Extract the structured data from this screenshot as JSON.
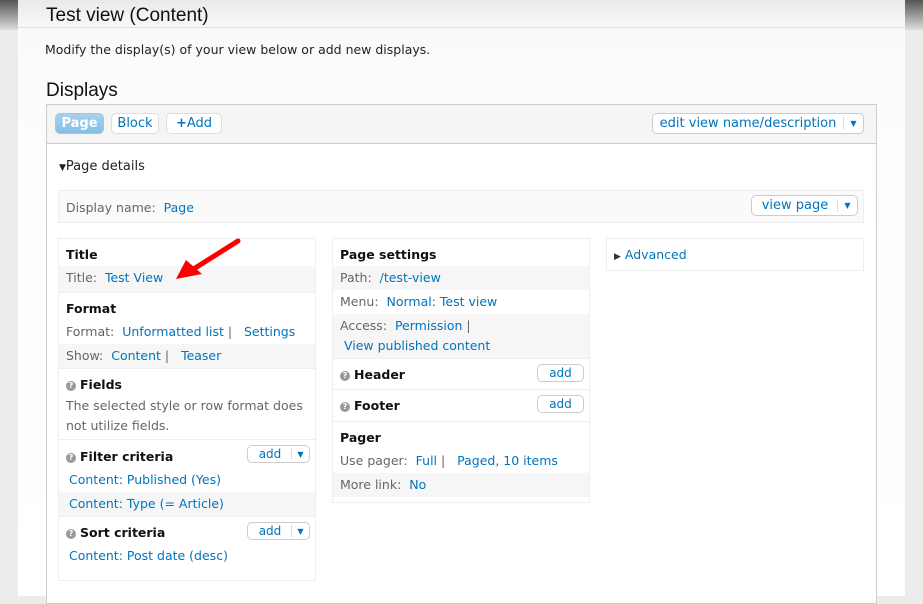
{
  "header": {
    "title": "Test view (Content)",
    "description": "Modify the display(s) of your view below or add new displays.",
    "displays_heading": "Displays"
  },
  "tabs": [
    {
      "label": "Page",
      "active": true
    },
    {
      "label": "Block"
    },
    {
      "label": "Add",
      "icon": "plus-icon"
    }
  ],
  "edit_view_label": "edit view name/description",
  "details": {
    "heading": "Page details",
    "display_name_label": "Display name:",
    "display_name": "Page",
    "view_page_label": "view page"
  },
  "col1": {
    "title_heading": "Title",
    "title_label": "Title:",
    "title_value": "Test View",
    "format_heading": "Format",
    "format_label": "Format:",
    "format_value": "Unformatted list",
    "format_settings": "Settings",
    "show_label": "Show:",
    "show_value": "Content",
    "show_mode": "Teaser",
    "fields_heading": "Fields",
    "fields_note": "The selected style or row format does not utilize fields.",
    "filter_heading": "Filter criteria",
    "filters": [
      "Content: Published (Yes)",
      "Content: Type (= Article)"
    ],
    "sort_heading": "Sort criteria",
    "sorts": [
      "Content: Post date (desc)"
    ],
    "add_label": "add"
  },
  "col2": {
    "heading": "Page settings",
    "path_label": "Path:",
    "path": "/test-view",
    "menu_label": "Menu:",
    "menu": "Normal: Test view",
    "access_label": "Access:",
    "access": "Permission",
    "access_perm": "View published content",
    "header_heading": "Header",
    "footer_heading": "Footer",
    "add_label": "add",
    "pager_heading": "Pager",
    "use_pager_label": "Use pager:",
    "pager_type": "Full",
    "pager_items": "Paged, 10 items",
    "more_link_label": "More link:",
    "more_link": "No"
  },
  "col3": {
    "advanced": "Advanced"
  },
  "colors": {
    "link": "#0074bd",
    "active_tab": "#8fc3e6",
    "arrow": "#ff0000"
  }
}
